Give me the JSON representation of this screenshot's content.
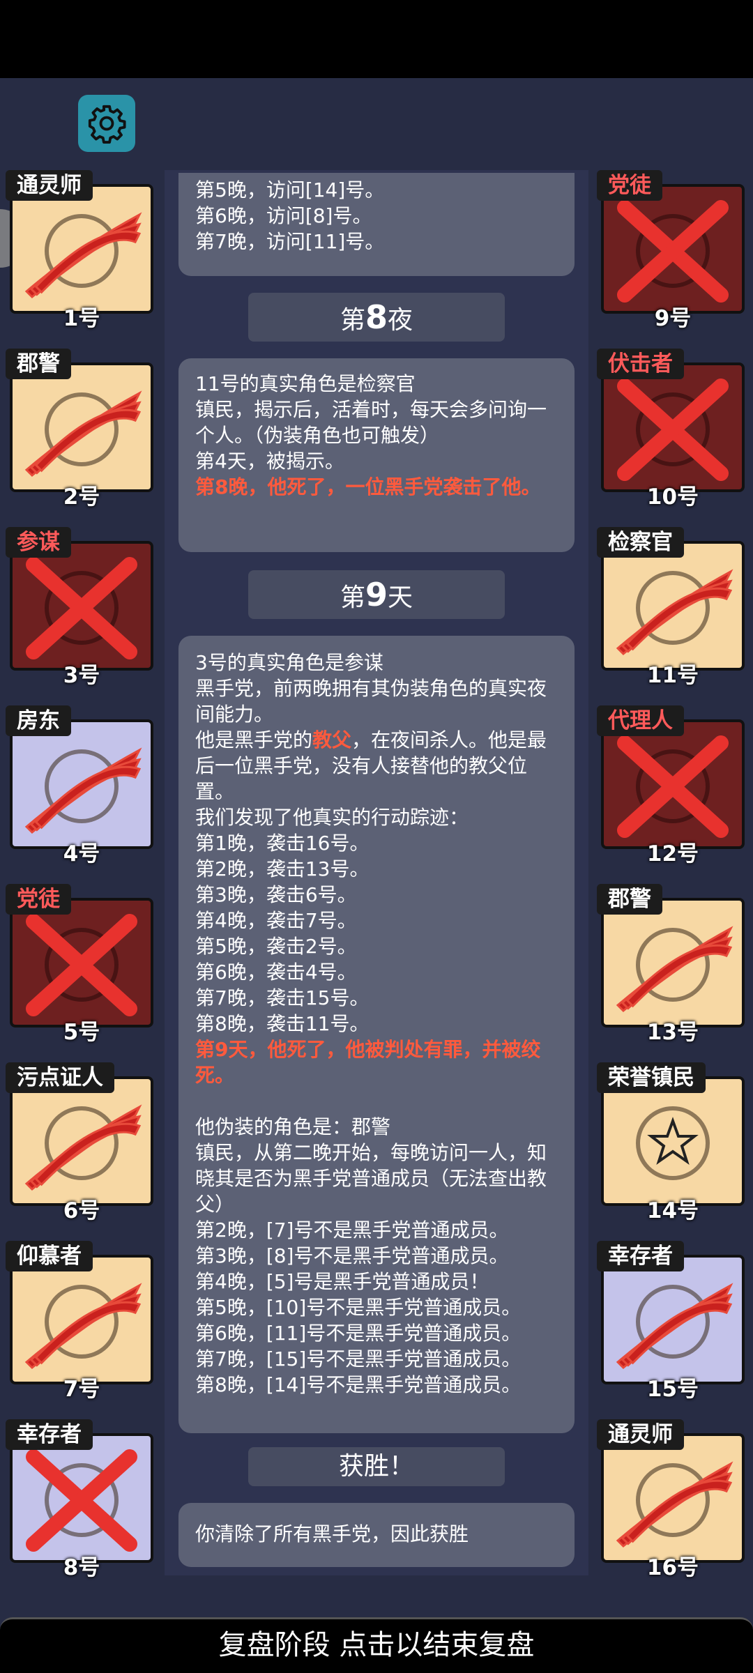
{
  "top_bar": {},
  "settings": {
    "icon": "gear-icon",
    "color": "#2a93a8"
  },
  "left_players": [
    {
      "role": "通灵师",
      "number": "1号",
      "role_color": "white",
      "bg": "light",
      "mark": "claw"
    },
    {
      "role": "郡警",
      "number": "2号",
      "role_color": "white",
      "bg": "light",
      "mark": "claw"
    },
    {
      "role": "参谋",
      "number": "3号",
      "role_color": "red",
      "bg": "red",
      "mark": "x"
    },
    {
      "role": "房东",
      "number": "4号",
      "role_color": "white",
      "bg": "lav",
      "mark": "claw"
    },
    {
      "role": "党徒",
      "number": "5号",
      "role_color": "red",
      "bg": "red",
      "mark": "x"
    },
    {
      "role": "污点证人",
      "number": "6号",
      "role_color": "white",
      "bg": "light",
      "mark": "claw"
    },
    {
      "role": "仰慕者",
      "number": "7号",
      "role_color": "white",
      "bg": "light",
      "mark": "claw"
    },
    {
      "role": "幸存者",
      "number": "8号",
      "role_color": "white",
      "bg": "lav",
      "mark": "x"
    }
  ],
  "right_players": [
    {
      "role": "党徒",
      "number": "9号",
      "role_color": "red",
      "bg": "red",
      "mark": "x"
    },
    {
      "role": "伏击者",
      "number": "10号",
      "role_color": "red",
      "bg": "red",
      "mark": "x"
    },
    {
      "role": "检察官",
      "number": "11号",
      "role_color": "white",
      "bg": "light",
      "mark": "claw"
    },
    {
      "role": "代理人",
      "number": "12号",
      "role_color": "red",
      "bg": "red",
      "mark": "x"
    },
    {
      "role": "郡警",
      "number": "13号",
      "role_color": "white",
      "bg": "light",
      "mark": "claw"
    },
    {
      "role": "荣誉镇民",
      "number": "14号",
      "role_color": "white",
      "bg": "light",
      "mark": "none"
    },
    {
      "role": "幸存者",
      "number": "15号",
      "role_color": "white",
      "bg": "lav",
      "mark": "claw"
    },
    {
      "role": "通灵师",
      "number": "16号",
      "role_color": "white",
      "bg": "light",
      "mark": "claw"
    }
  ],
  "log": {
    "panel1_lines": [
      "第5晚，访问[14]号。",
      "第6晚，访问[8]号。",
      "第7晚，访问[11]号。"
    ],
    "header1": {
      "prefix": "第",
      "num": "8",
      "suffix": "夜"
    },
    "panel2": {
      "line1": "11号的真实角色是检察官",
      "line2": "镇民，揭示后，活着时，每天会多问询一个人。（伪装角色也可触发）",
      "line3": "第4天，被揭示。",
      "highlight": "第8晚，他死了，一位黑手党袭击了他。"
    },
    "header2": {
      "prefix": "第",
      "num": "9",
      "suffix": "天"
    },
    "panel3": {
      "line1": "3号的真实角色是参谋",
      "line2": "黑手党，前两晚拥有其伪装角色的真实夜间能力。",
      "line3_pre": "他是黑手党的",
      "line3_hl": "教父",
      "line3_post": "，在夜间杀人。他是最后一位黑手党，没有人接替他的教父位置。",
      "line4": "我们发现了他真实的行动踪迹：",
      "actions": [
        "第1晚，袭击16号。",
        "第2晚，袭击13号。",
        "第3晚，袭击6号。",
        "第4晚，袭击7号。",
        "第5晚，袭击2号。",
        "第6晚，袭击4号。",
        "第7晚，袭击15号。",
        "第8晚，袭击11号。"
      ],
      "highlight": "第9天，他死了，他被判处有罪，并被绞死。",
      "disguise": "他伪装的角色是：郡警",
      "disguise_desc": "镇民，从第二晚开始，每晚访问一人，知晓其是否为黑手党普通成员（无法查出教父）",
      "checks": [
        "第2晚，[7]号不是黑手党普通成员。",
        "第3晚，[8]号不是黑手党普通成员。",
        "第4晚，[5]号是黑手党普通成员！",
        "第5晚，[10]号不是黑手党普通成员。",
        "第6晚，[11]号不是黑手党普通成员。",
        "第7晚，[15]号不是黑手党普通成员。",
        "第8晚，[14]号不是黑手党普通成员。"
      ]
    },
    "header3": "获胜！",
    "panel4": "你清除了所有黑手党，因此获胜"
  },
  "bottom_bar": {
    "label": "复盘阶段 点击以结束复盘"
  }
}
